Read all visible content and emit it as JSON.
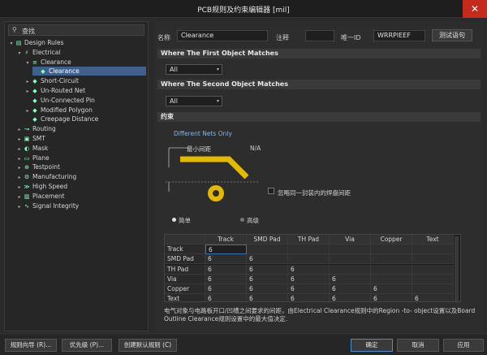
{
  "window": {
    "title": "PCB规则及约束编辑器 [mil]",
    "close": "✕"
  },
  "search": {
    "placeholder": "查找"
  },
  "tree": [
    {
      "label": "Design Rules",
      "arrow": "▾",
      "icon": "folder-icon"
    },
    {
      "label": "Electrical",
      "arrow": "▾",
      "icon": "electrical-icon"
    },
    {
      "label": "Clearance",
      "arrow": "▾",
      "icon": "clearance-icon"
    },
    {
      "label": "Clearance",
      "arrow": "",
      "icon": "rule-icon",
      "selected": true
    },
    {
      "label": "Short-Circuit",
      "arrow": "▸",
      "icon": "rule-icon"
    },
    {
      "label": "Un-Routed Net",
      "arrow": "▸",
      "icon": "rule-icon"
    },
    {
      "label": "Un-Connected Pin",
      "arrow": "",
      "icon": "rule-icon"
    },
    {
      "label": "Modified Polygon",
      "arrow": "▸",
      "icon": "rule-icon"
    },
    {
      "label": "Creepage Distance",
      "arrow": "",
      "icon": "rule-icon"
    },
    {
      "label": "Routing",
      "arrow": "▸",
      "icon": "routing-icon"
    },
    {
      "label": "SMT",
      "arrow": "▸",
      "icon": "smt-icon"
    },
    {
      "label": "Mask",
      "arrow": "▸",
      "icon": "mask-icon"
    },
    {
      "label": "Plane",
      "arrow": "▸",
      "icon": "plane-icon"
    },
    {
      "label": "Testpoint",
      "arrow": "▸",
      "icon": "testpoint-icon"
    },
    {
      "label": "Manufacturing",
      "arrow": "▸",
      "icon": "manufacturing-icon"
    },
    {
      "label": "High Speed",
      "arrow": "▸",
      "icon": "highspeed-icon"
    },
    {
      "label": "Placement",
      "arrow": "▸",
      "icon": "placement-icon"
    },
    {
      "label": "Signal Integrity",
      "arrow": "▸",
      "icon": "signal-icon"
    }
  ],
  "rule": {
    "name_label": "名称",
    "name_value": "Clearance",
    "comment_label": "注释",
    "comment_value": "",
    "id_label": "唯一ID",
    "id_value": "WRRPIEEF",
    "test_button": "测试语句"
  },
  "first_match": {
    "title": "Where The First Object Matches",
    "value": "All"
  },
  "second_match": {
    "title": "Where The Second Object Matches",
    "value": "All"
  },
  "constraints": {
    "title": "约束",
    "net_scope": "Different Nets Only",
    "min_clearance_label": "最小间距",
    "min_clearance_value": "N/A",
    "ignore_pad_label": "忽略同一封装内的焊盘间距",
    "mode_simple": "简单",
    "mode_advanced": "高级"
  },
  "matrix": {
    "columns": [
      "Track",
      "SMD Pad",
      "TH Pad",
      "Via",
      "Copper",
      "Text"
    ],
    "rows": [
      {
        "label": "Track",
        "values": [
          "6",
          "",
          "",
          "",
          "",
          ""
        ]
      },
      {
        "label": "SMD Pad",
        "values": [
          "6",
          "6",
          "",
          "",
          "",
          ""
        ]
      },
      {
        "label": "TH Pad",
        "values": [
          "6",
          "6",
          "6",
          "",
          "",
          ""
        ]
      },
      {
        "label": "Via",
        "values": [
          "6",
          "6",
          "6",
          "6",
          "",
          ""
        ]
      },
      {
        "label": "Copper",
        "values": [
          "6",
          "6",
          "6",
          "6",
          "6",
          ""
        ]
      },
      {
        "label": "Text",
        "values": [
          "6",
          "6",
          "6",
          "6",
          "6",
          "6"
        ]
      }
    ]
  },
  "description": "电气对象与电路板开口/凹槽之间要求的间距，由Electrical Clearance规则中的Region -to- object设置以及Board Outline Clearance规则设置中的最大值决定.",
  "footer": {
    "wizard": "规则向导 (R)...",
    "priority": "优先级 (P)...",
    "defaults": "创建默认规则 (C)",
    "ok": "确定",
    "cancel": "取消",
    "apply": "应用"
  },
  "colors": {
    "accent": "#4a8ad0",
    "selected_row": "#3f5f8c",
    "close": "#c42b1c",
    "copper": "#e5b800"
  }
}
